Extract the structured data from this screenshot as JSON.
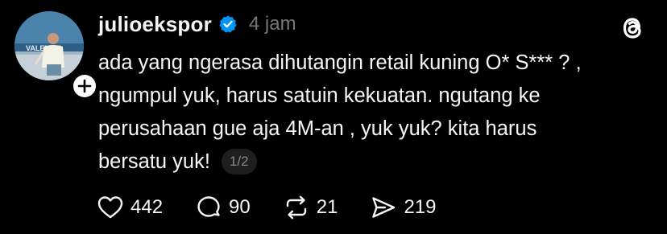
{
  "post": {
    "username": "julioekspor",
    "time": "4 jam",
    "avatar_text": "VALENCIA",
    "lines": [
      "ada yang ngerasa dihutangin retail kuning O* S*** ? ,",
      "ngumpul yuk, harus satuin kekuatan. ngutang ke",
      "perusahaan gue aja 4M-an , yuk yuk? kita harus",
      "bersatu yuk!"
    ],
    "page_indicator": "1/2"
  },
  "actions": {
    "likes": "442",
    "replies": "90",
    "reposts": "21",
    "shares": "219"
  },
  "icons": {
    "verified": "verified-badge-icon",
    "follow": "plus-icon",
    "logo": "threads-logo-icon",
    "like": "heart-icon",
    "reply": "comment-icon",
    "repost": "repost-icon",
    "share": "send-icon"
  },
  "colors": {
    "background": "#000000",
    "text": "#f3f5f7",
    "muted": "#777777",
    "verified": "#0095f6"
  }
}
